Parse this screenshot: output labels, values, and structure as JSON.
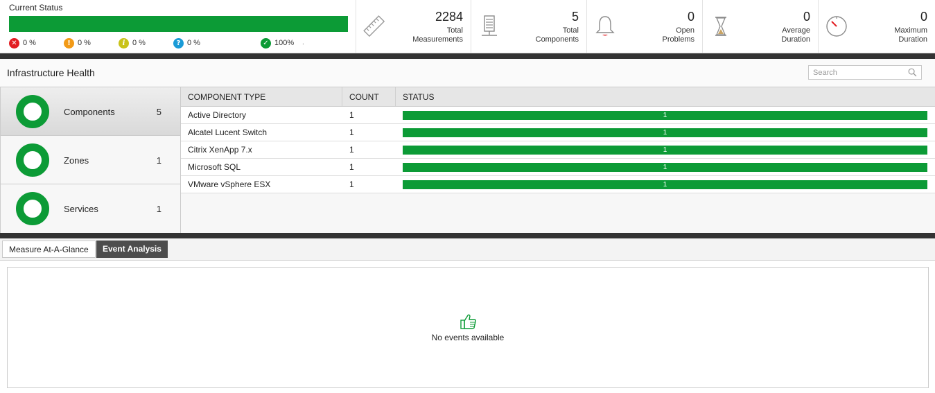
{
  "current_status": {
    "title": "Current Status",
    "bar_fill_percent": 100,
    "bar_color": "#0c9b36",
    "severities": [
      {
        "icon": "critical-x-icon",
        "glyph": "✕",
        "color": "#e21d22",
        "value": "0 %"
      },
      {
        "icon": "major-exclamation-icon",
        "glyph": "!",
        "color": "#f29a17",
        "value": "0 %"
      },
      {
        "icon": "minor-info-icon",
        "glyph": "i",
        "color": "#c9c31a",
        "value": "0 %"
      },
      {
        "icon": "unknown-question-icon",
        "glyph": "?",
        "color": "#1a9bd7",
        "value": "0 %"
      },
      {
        "icon": "normal-check-icon",
        "glyph": "✓",
        "color": "#0c9b36",
        "value": "100%"
      }
    ],
    "trail_mark": "."
  },
  "metrics": [
    {
      "icon": "ruler-icon",
      "value": "2284",
      "label_line1": "Total",
      "label_line2": "Measurements"
    },
    {
      "icon": "server-icon",
      "value": "5",
      "label_line1": "Total",
      "label_line2": "Components"
    },
    {
      "icon": "bell-icon",
      "value": "0",
      "label_line1": "Open",
      "label_line2": "Problems"
    },
    {
      "icon": "hourglass-icon",
      "value": "0",
      "label_line1": "Average",
      "label_line2": "Duration"
    },
    {
      "icon": "gauge-icon",
      "value": "0",
      "label_line1": "Maximum",
      "label_line2": "Duration"
    }
  ],
  "infrastructure": {
    "title": "Infrastructure Health",
    "search_placeholder": "Search",
    "categories": [
      {
        "label": "Components",
        "count": "5",
        "active": true
      },
      {
        "label": "Zones",
        "count": "1",
        "active": false
      },
      {
        "label": "Services",
        "count": "1",
        "active": false
      }
    ],
    "columns": [
      "COMPONENT TYPE",
      "COUNT",
      "STATUS"
    ],
    "rows": [
      {
        "type": "Active Directory",
        "count": "1",
        "status": "1"
      },
      {
        "type": "Alcatel Lucent Switch",
        "count": "1",
        "status": "1"
      },
      {
        "type": "Citrix XenApp 7.x",
        "count": "1",
        "status": "1"
      },
      {
        "type": "Microsoft SQL",
        "count": "1",
        "status": "1"
      },
      {
        "type": "VMware vSphere ESX",
        "count": "1",
        "status": "1"
      }
    ]
  },
  "tabs": {
    "measure": "Measure At-A-Glance",
    "events": "Event Analysis",
    "active": "events"
  },
  "events": {
    "empty_message": "No events available",
    "icon": "thumbs-up-icon"
  }
}
